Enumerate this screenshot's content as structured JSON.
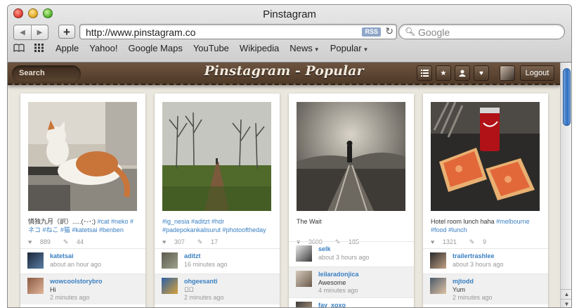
{
  "window": {
    "title": "Pinstagram"
  },
  "toolbar": {
    "back": "◀",
    "forward": "▶",
    "add": "+",
    "url": "http://www.pinstagram.co",
    "rss": "RSS",
    "reload": "↻",
    "search_placeholder": "Google"
  },
  "bookmarks": [
    {
      "label": "Apple"
    },
    {
      "label": "Yahoo!"
    },
    {
      "label": "Google Maps"
    },
    {
      "label": "YouTube"
    },
    {
      "label": "Wikipedia"
    },
    {
      "label": "News",
      "menu": true
    },
    {
      "label": "Popular",
      "menu": true
    }
  ],
  "app": {
    "search_label": "Search",
    "title": "Pinstagram - Popular",
    "logout": "Logout",
    "icons": [
      "list-icon",
      "star-icon",
      "user-icon",
      "heart-icon"
    ]
  },
  "cards": [
    {
      "caption_plain": "憐独九月（訳）.....(･-･;) ",
      "caption_tags": "#cat #neko #ネコ #ねこ #猫 #katetsai #benben",
      "likes": "889",
      "comments": "44",
      "comment_list": [
        {
          "user": "katetsai",
          "text": "",
          "time": "about an hour ago"
        },
        {
          "user": "wowcoolstorybro",
          "text": "Hi",
          "time": "2 minutes ago"
        }
      ]
    },
    {
      "caption_plain": "",
      "caption_tags": "#ig_nesia #aditzt #hdr #padepokankalisurut #photooftheday",
      "likes": "307",
      "comments": "17",
      "comment_list": [
        {
          "user": "aditzt",
          "text": "",
          "time": "16 minutes ago"
        },
        {
          "user": "ohgeesanti",
          "text": "󾌵󾌵",
          "time": "2 minutes ago"
        }
      ]
    },
    {
      "caption_plain": "The Wait",
      "caption_tags": "",
      "likes": "3600",
      "comments": "185",
      "comment_list": [
        {
          "user": "selk",
          "text": "",
          "time": "about 3 hours ago"
        },
        {
          "user": "leilaradonjica",
          "text": "Awesome",
          "time": "4 minutes ago"
        },
        {
          "user": "fay_xoxo",
          "text": "",
          "time": ""
        }
      ]
    },
    {
      "caption_plain": "Hotel room lunch haha ",
      "caption_tags": "#melbourne #food #lunch",
      "likes": "1321",
      "comments": "9",
      "comment_list": [
        {
          "user": "trailertrashlee",
          "text": "",
          "time": "about 3 hours ago"
        },
        {
          "user": "mjtodd",
          "text": "Yum",
          "time": "2 minutes ago"
        }
      ]
    }
  ]
}
